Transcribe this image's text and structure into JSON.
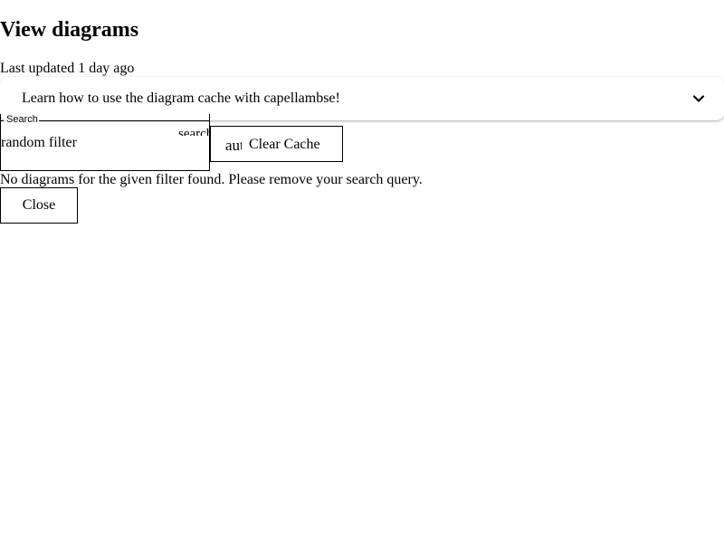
{
  "page": {
    "title": "View diagrams",
    "last_updated": "Last updated 1 day ago"
  },
  "help_accordion": {
    "title": "Learn how to use the diagram cache with capellambse!",
    "expand_icon": "chevron-down-icon",
    "expanded": false
  },
  "search": {
    "legend": "Search",
    "value": "random filter",
    "icon_text": "search",
    "icon": "search-icon"
  },
  "clear_cache_button": {
    "icon_text": "autorenew",
    "icon": "autorenew-icon",
    "label": "Clear Cache"
  },
  "empty_message": "No diagrams for the given filter found. Please remove your search query.",
  "close_button": {
    "label": "Close"
  },
  "colors": {
    "background": "#ffffff",
    "text": "#000000",
    "border": "#000000"
  }
}
